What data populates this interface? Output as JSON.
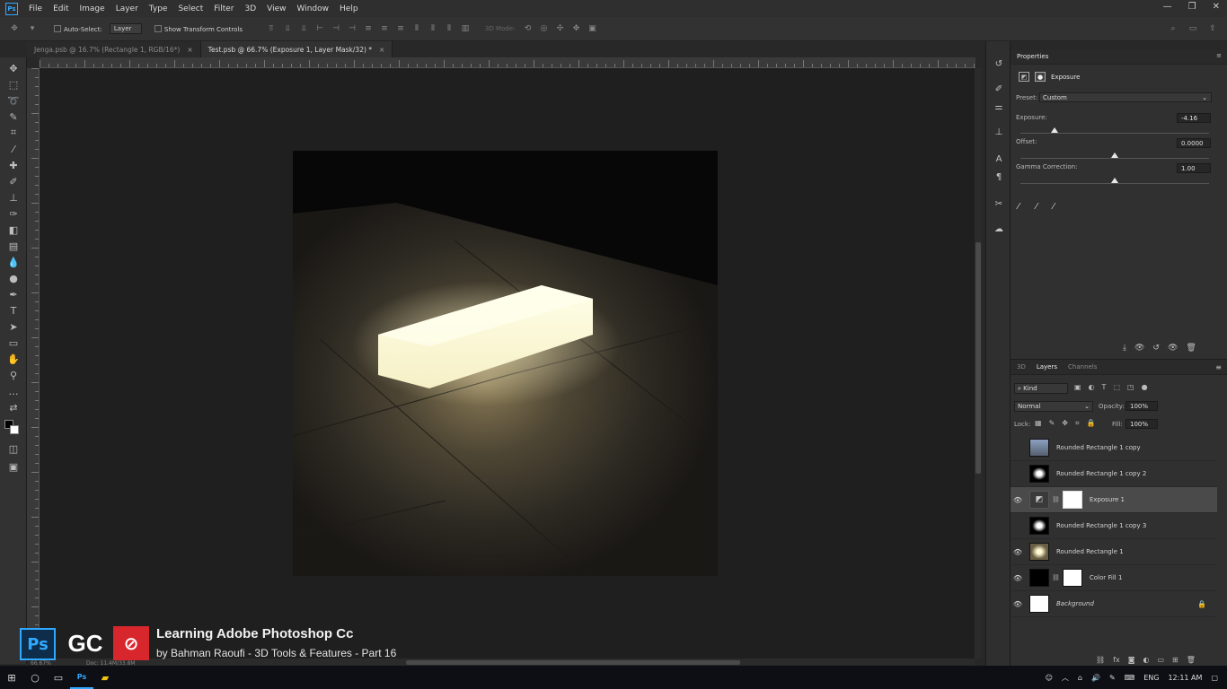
{
  "app": {
    "logo_text": "Ps"
  },
  "menu": [
    "File",
    "Edit",
    "Image",
    "Layer",
    "Type",
    "Select",
    "Filter",
    "3D",
    "View",
    "Window",
    "Help"
  ],
  "window_controls": [
    "—",
    "❐",
    "✕"
  ],
  "options": {
    "auto_select_label": "Auto-Select:",
    "auto_select_value": "Layer",
    "show_transform_label": "Show Transform Controls",
    "mode_label": "3D Mode:"
  },
  "tabs": [
    {
      "label": "Jenga.psb @ 16.7% (Rectangle 1, RGB/16*)",
      "close": "×"
    },
    {
      "label": "Test.psb @ 66.7% (Exposure 1, Layer Mask/32) *",
      "close": "×"
    }
  ],
  "properties": {
    "title": "Properties",
    "adjustment_name": "Exposure",
    "preset_label": "Preset:",
    "preset_value": "Custom",
    "exposure_label": "Exposure:",
    "exposure_value": "-4.16",
    "exposure_level": 0.18,
    "offset_label": "Offset:",
    "offset_value": "0.0000",
    "offset_level": 0.5,
    "gamma_label": "Gamma Correction:",
    "gamma_value": "1.00",
    "gamma_level": 0.5
  },
  "layers_panel": {
    "tabs": [
      "3D",
      "Layers",
      "Channels"
    ],
    "filter_label": "Kind",
    "blend_mode": "Normal",
    "opacity_label": "Opacity:",
    "opacity_value": "100%",
    "lock_label": "Lock:",
    "fill_label": "Fill:",
    "fill_value": "100%",
    "layers": [
      {
        "name": "Rounded Rectangle 1 copy",
        "visible": false
      },
      {
        "name": "Rounded Rectangle 1 copy 2",
        "visible": false
      },
      {
        "name": "Exposure 1",
        "visible": true,
        "selected": true
      },
      {
        "name": "Rounded Rectangle 1 copy 3",
        "visible": false
      },
      {
        "name": "Rounded Rectangle 1",
        "visible": true
      },
      {
        "name": "Color Fill 1",
        "visible": true
      },
      {
        "name": "Background",
        "visible": true,
        "locked": true
      }
    ]
  },
  "status": {
    "zoom": "66.67%",
    "doc": "Doc: 11.4M/33.8M"
  },
  "watermark": {
    "ps": "Ps",
    "gc": "GC",
    "title": "Learning Adobe Photoshop Cc",
    "subtitle": "by Bahman Raoufi - 3D Tools & Features - Part 16"
  },
  "taskbar": {
    "lang": "ENG",
    "time": "12:11 AM"
  },
  "colors": {
    "accent": "#31a8ff",
    "panel": "#303030",
    "canvas_bg": "#1f1f1f",
    "selected_row": "#4a4a4a"
  }
}
